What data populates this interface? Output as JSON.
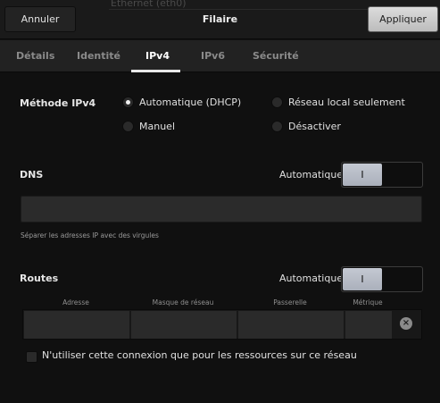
{
  "header": {
    "background_title": "Ethernet (eth0)",
    "title": "Filaire",
    "cancel_label": "Annuler",
    "apply_label": "Appliquer"
  },
  "tabs": [
    {
      "label": "Détails",
      "active": false
    },
    {
      "label": "Identité",
      "active": false
    },
    {
      "label": "IPv4",
      "active": true
    },
    {
      "label": "IPv6",
      "active": false
    },
    {
      "label": "Sécurité",
      "active": false
    }
  ],
  "ipv4_method": {
    "label": "Méthode IPv4",
    "options": [
      {
        "label": "Automatique (DHCP)",
        "selected": true
      },
      {
        "label": "Réseau local seulement",
        "selected": false
      },
      {
        "label": "Manuel",
        "selected": false
      },
      {
        "label": "Désactiver",
        "selected": false
      }
    ]
  },
  "dns": {
    "label": "DNS",
    "auto_label": "Automatique",
    "switch_state": "I",
    "value": "",
    "hint": "Séparer les adresses IP avec des virgules"
  },
  "routes": {
    "label": "Routes",
    "auto_label": "Automatique",
    "switch_state": "I",
    "columns": [
      "Adresse",
      "Masque de réseau",
      "Passerelle",
      "Métrique"
    ],
    "delete_icon": "close-circle-icon"
  },
  "only_local_checkbox": {
    "label": "N'utiliser cette connexion que pour les ressources sur ce réseau",
    "checked": false
  },
  "colors": {
    "background": "#101010",
    "apply_button": "#c8c8c8",
    "switch_knob": "#b8bdc6"
  }
}
